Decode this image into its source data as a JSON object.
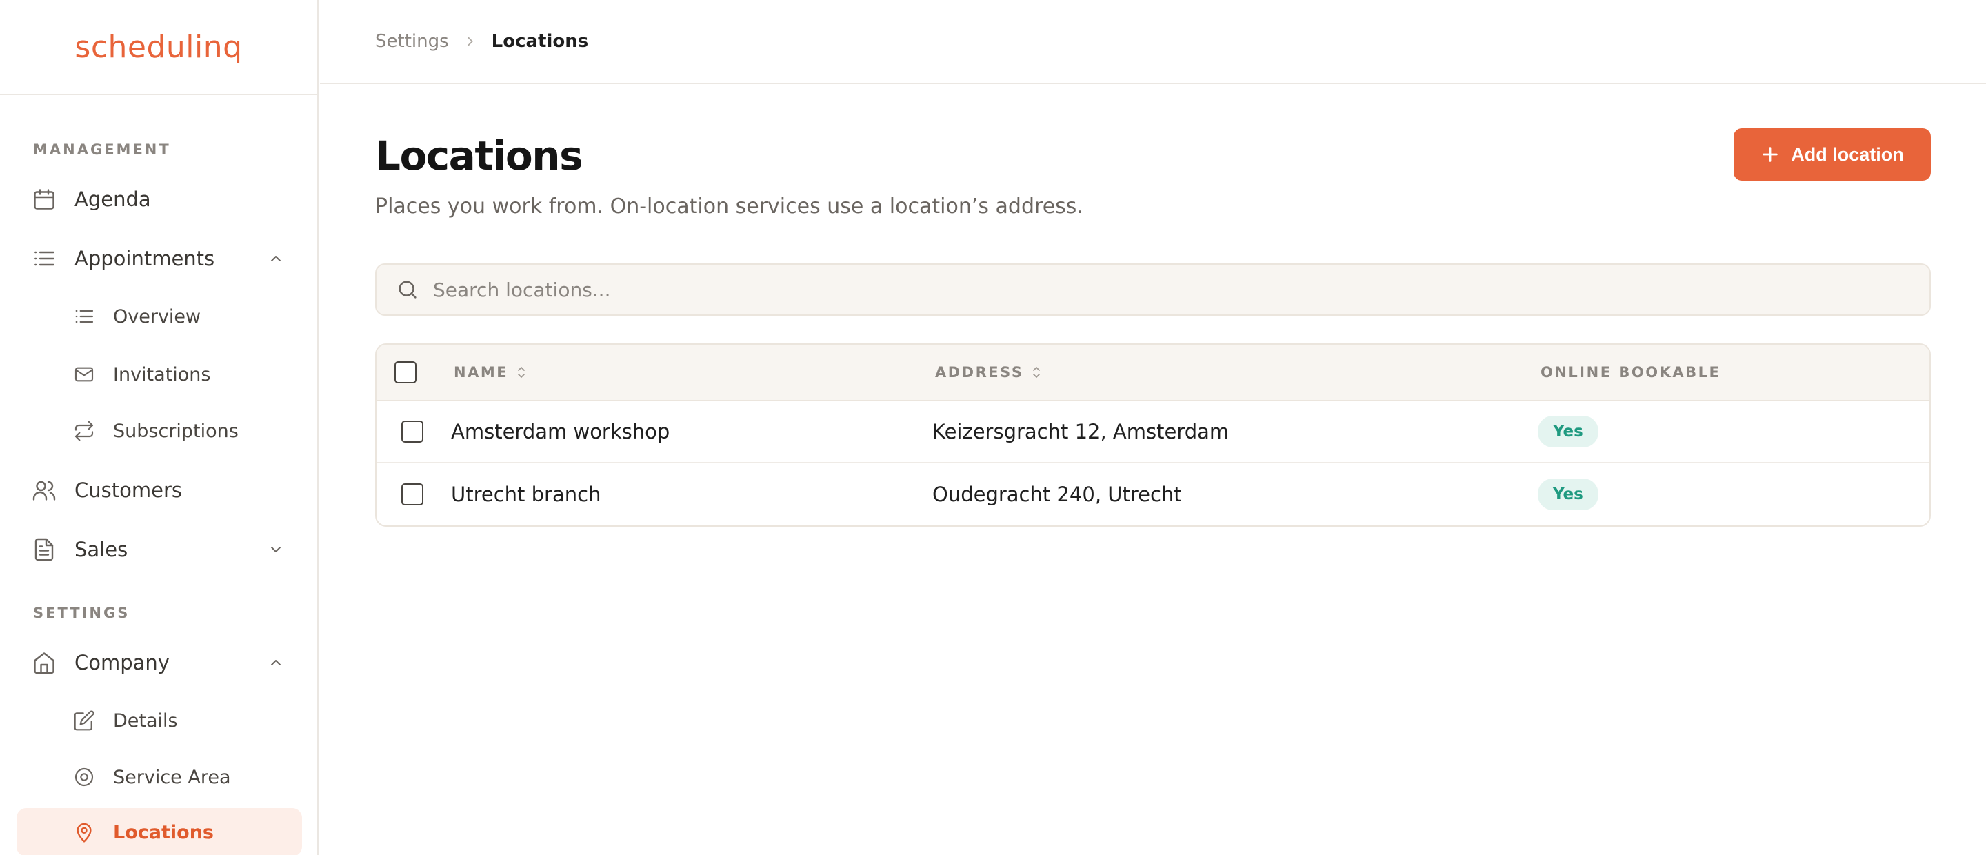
{
  "app": {
    "logo_text": "schedulinq",
    "brand_color": "#e8643a"
  },
  "sidebar": {
    "management_title": "MANAGEMENT",
    "settings_title": "SETTINGS",
    "items": {
      "agenda": "Agenda",
      "appointments": "Appointments",
      "overview": "Overview",
      "invitations": "Invitations",
      "subscriptions": "Subscriptions",
      "customers": "Customers",
      "sales": "Sales",
      "company": "Company",
      "details": "Details",
      "service_area": "Service Area",
      "locations": "Locations"
    },
    "active_item": "locations"
  },
  "breadcrumb": {
    "parent": "Settings",
    "current": "Locations"
  },
  "page": {
    "title": "Locations",
    "subtitle": "Places you work from. On-location services use a location’s address.",
    "add_button_label": "Add location"
  },
  "search": {
    "placeholder": "Search locations..."
  },
  "table": {
    "columns": {
      "name": "NAME",
      "address": "ADDRESS",
      "online_bookable": "ONLINE BOOKABLE"
    },
    "rows": [
      {
        "name": "Amsterdam workshop",
        "address": "Keizersgracht 12, Amsterdam",
        "online_bookable": "Yes"
      },
      {
        "name": "Utrecht branch",
        "address": "Oudegracht 240, Utrecht",
        "online_bookable": "Yes"
      }
    ]
  }
}
